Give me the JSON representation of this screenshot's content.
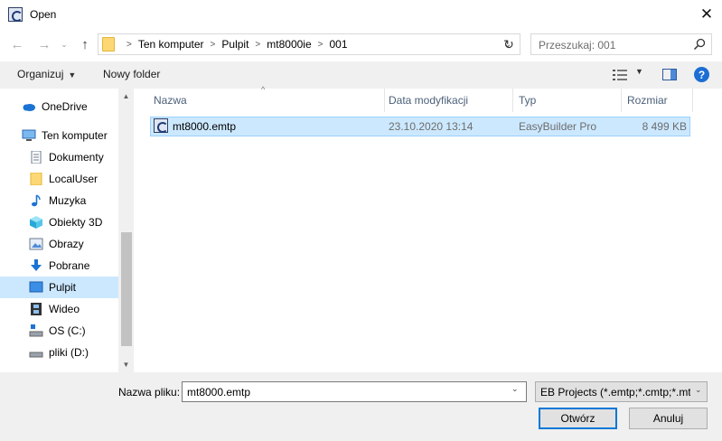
{
  "window": {
    "title": "Open",
    "close_glyph": "✕"
  },
  "nav_buttons": {
    "back": "←",
    "forward": "→",
    "recent": "⌄",
    "up": "↑"
  },
  "address": {
    "crumbs": [
      "Ten komputer",
      "Pulpit",
      "mt8000ie",
      "001"
    ],
    "separator": ">",
    "dropdown": "⌄",
    "refresh": "↻"
  },
  "search": {
    "placeholder": "Przeszukaj: 001"
  },
  "toolbar": {
    "organize_label": "Organizuj",
    "caret": "▼",
    "new_folder_label": "Nowy folder",
    "help": "?"
  },
  "sidebar": {
    "items": [
      {
        "label": "OneDrive",
        "icon": "cloud-icon"
      },
      {
        "label": "Ten komputer",
        "icon": "computer-icon"
      },
      {
        "label": "Dokumenty",
        "icon": "document-icon"
      },
      {
        "label": "LocalUser",
        "icon": "folder-icon"
      },
      {
        "label": "Muzyka",
        "icon": "music-icon"
      },
      {
        "label": "Obiekty 3D",
        "icon": "cube-icon"
      },
      {
        "label": "Obrazy",
        "icon": "picture-icon"
      },
      {
        "label": "Pobrane",
        "icon": "download-icon"
      },
      {
        "label": "Pulpit",
        "icon": "desktop-icon",
        "selected": true
      },
      {
        "label": "Wideo",
        "icon": "film-icon"
      },
      {
        "label": "OS (C:)",
        "icon": "drive-icon"
      },
      {
        "label": "pliki (D:)",
        "icon": "drive-icon"
      }
    ],
    "scroll_up": "▲",
    "scroll_down": "▼"
  },
  "columns": {
    "name": "Nazwa",
    "date": "Data modyfikacji",
    "type": "Typ",
    "size": "Rozmiar",
    "sort_glyph": "^"
  },
  "files": [
    {
      "name": "mt8000.emtp",
      "date": "23.10.2020 13:14",
      "type": "EasyBuilder Pro",
      "size": "8 499 KB"
    }
  ],
  "footer": {
    "filename_label": "Nazwa pliku:",
    "filename_value": "mt8000.emtp",
    "filter_value": "EB Projects (*.emtp;*.cmtp;*.mtp)",
    "dropdown": "⌄",
    "open_label": "Otwórz",
    "cancel_label": "Anuluj"
  },
  "colors": {
    "accent": "#0078d7",
    "selection": "#cce8ff"
  }
}
